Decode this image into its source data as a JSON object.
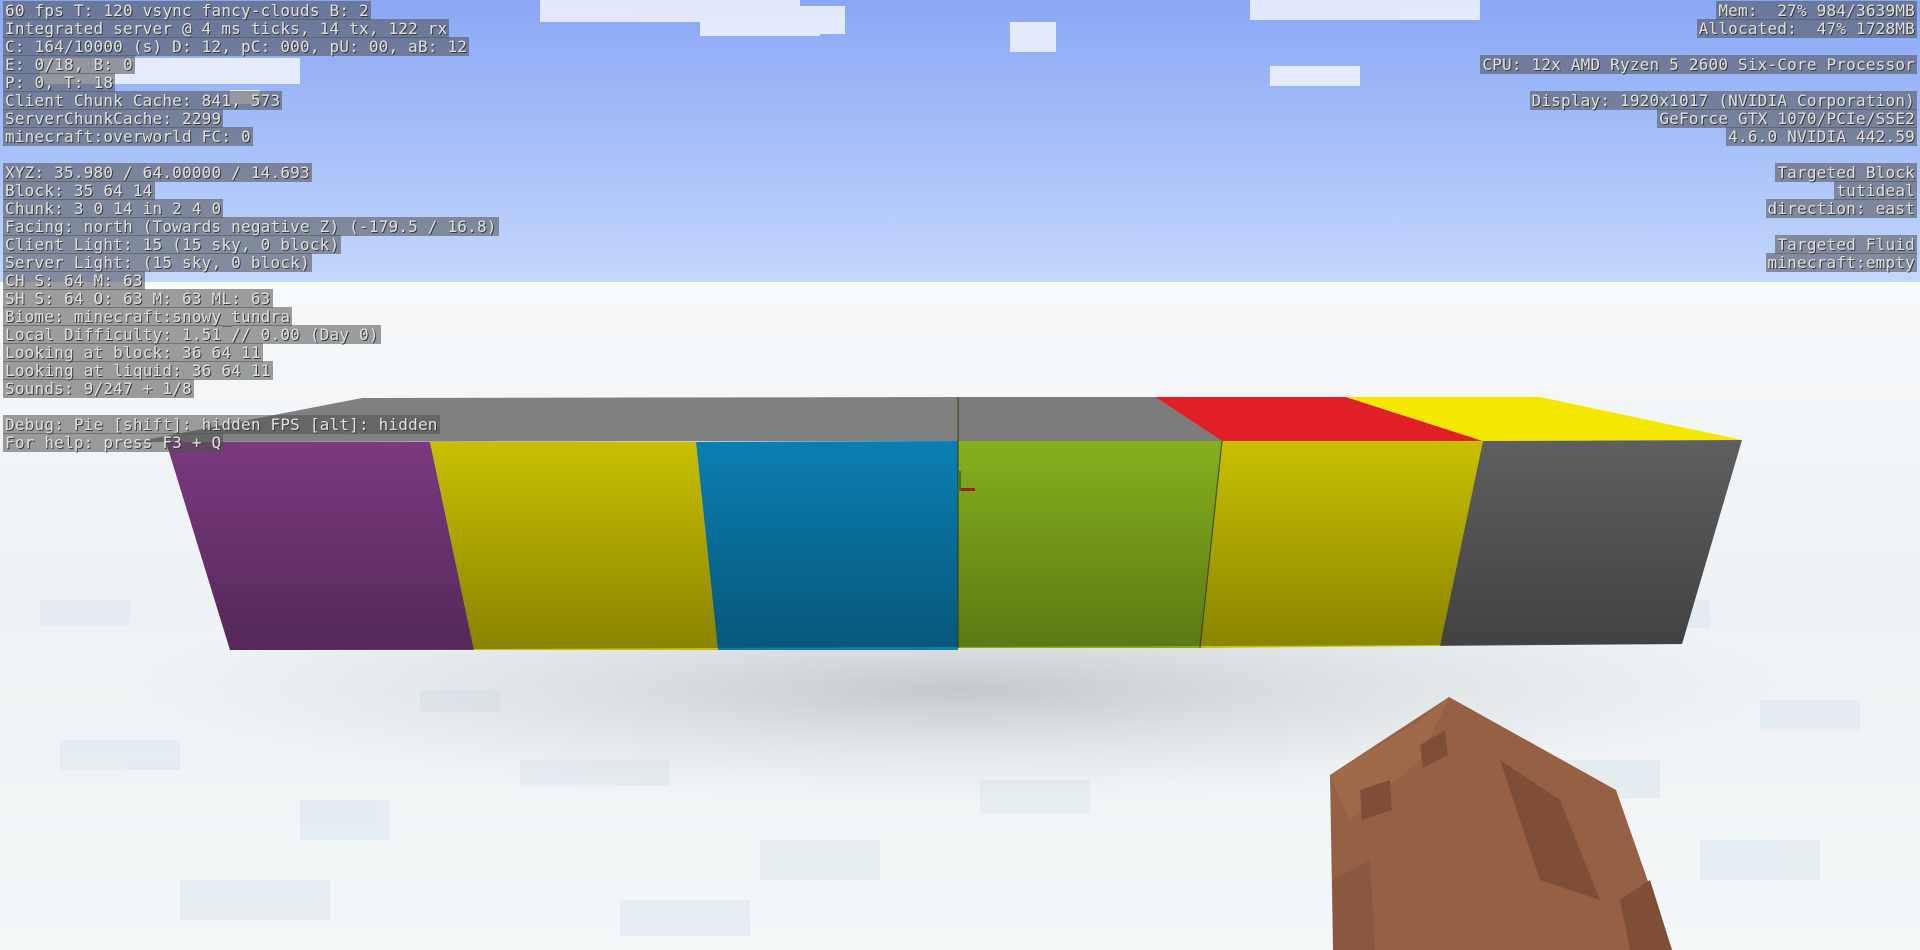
{
  "debug_left": [
    "60 fps T: 120 vsync fancy-clouds B: 2",
    "Integrated server @ 4 ms ticks, 14 tx, 122 rx",
    "C: 164/10000 (s) D: 12, pC: 000, pU: 00, aB: 12",
    "E: 0/18, B: 0",
    "P: 0, T: 18",
    "Client Chunk Cache: 841, 573",
    "ServerChunkCache: 2299",
    "minecraft:overworld FC: 0",
    "",
    "XYZ: 35.980 / 64.00000 / 14.693",
    "Block: 35 64 14",
    "Chunk: 3 0 14 in 2 4 0",
    "Facing: north (Towards negative Z) (-179.5 / 16.8)",
    "Client Light: 15 (15 sky, 0 block)",
    "Server Light: (15 sky, 0 block)",
    "CH S: 64 M: 63",
    "SH S: 64 O: 63 M: 63 ML: 63",
    "Biome: minecraft:snowy_tundra",
    "Local Difficulty: 1.51 // 0.00 (Day 0)",
    "Looking at block: 36 64 11",
    "Looking at liquid: 36 64 11",
    "Sounds: 9/247 + 1/8",
    "",
    "Debug: Pie [shift]: hidden FPS [alt]: hidden",
    "For help: press F3 + Q"
  ],
  "debug_right": [
    "Mem:  27% 984/3639MB",
    "Allocated:  47% 1728MB",
    "",
    "CPU: 12x AMD Ryzen 5 2600 Six-Core Processor",
    "",
    "Display: 1920x1017 (NVIDIA Corporation)",
    "GeForce GTX 1070/PCIe/SSE2",
    "4.6.0 NVIDIA 442.59",
    "",
    "Targeted Block",
    "tutideal",
    "direction: east",
    "",
    "Targeted Fluid",
    "minecraft:empty"
  ],
  "colors": {
    "sky_top": "#8aa7f5",
    "sky_bottom": "#b9d1fc",
    "snow": "#f4f7f9",
    "block_top_gray": "#7a7a7a",
    "purple": "#7b3a80",
    "yellow": "#c9c000",
    "cyan": "#0a7fb2",
    "lime": "#86b01c",
    "gray_side": "#5f5f5f",
    "red_top": "#e01f26",
    "yellow_top": "#f4e800",
    "hand": "#966044"
  }
}
